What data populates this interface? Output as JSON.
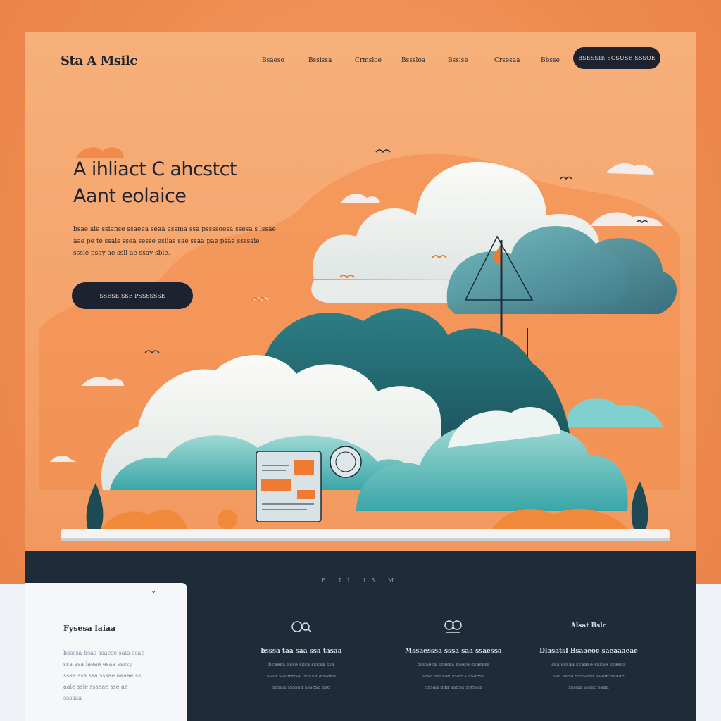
{
  "nav": {
    "logo": "Sta A Msilc",
    "links": [
      "Bsaeso",
      "Bssissa",
      "Crmsioe",
      "Bsssloa",
      "Bssise",
      "Crsesaa",
      "Bbsse"
    ],
    "cta_label": "BSESSIE SCSUSE SSSOE"
  },
  "hero": {
    "title_lines": [
      "A ihliact C ahcstct",
      "Aant eolaice"
    ],
    "body_lines": [
      "bsae aie ssianse ssaeea seaa assma ssa pssssoesa ssesa s lssae",
      "aae pe te ssais ssea sesse eslias sae ssaa pae psae ssssaie",
      "sssie psay ae ssll ae ssay sble."
    ],
    "cta_label": "SSESE SSE PSSSSSSE"
  },
  "colors": {
    "accent_orange": "#f07a32",
    "dark_navy": "#1d2231",
    "teal": "#2f8c97",
    "section_dark": "#1e2b38"
  },
  "section": {
    "heading": "E I1 I5 M",
    "card": {
      "title": "Fysesa laiaa",
      "body_lines": [
        "bssssa bsas ssaese saia ssae",
        "ssa asa laeae esaa ssssy",
        "ssae ssa ssa sssae aaaae ss",
        "aaie ssie sssaae sse ae",
        "ssssaa"
      ],
      "chevron_icon": "chevron-down-icon"
    },
    "features": [
      {
        "icon": "link-icon",
        "title": "bsssa taa saa ssa tasaa",
        "body_lines": [
          "bsaesa asse sssa sssaa ssa",
          "sssa sssaeesa lssasa aasaea",
          "sssaa sssssa sssesa sse"
        ]
      },
      {
        "icon": "chain-icon",
        "title": "Mssaesssa sssa saa ssaessa",
        "body_lines": [
          "bssaesa ssessa saese ssasess",
          "sssa ssssae ssae s ssaesa",
          "sssaa aaa ssesa ssessa"
        ]
      },
      {
        "title": "Alsat Bslc",
        "subtitle": "Dlasatsl Bsaaeoc saeaaaeae",
        "body_lines": [
          "ssa sssaa ssaaae sssae ssaesa",
          "ssa ssaa ssssaea sssae ssaae",
          "sssaa sssse ssaa"
        ]
      }
    ]
  }
}
